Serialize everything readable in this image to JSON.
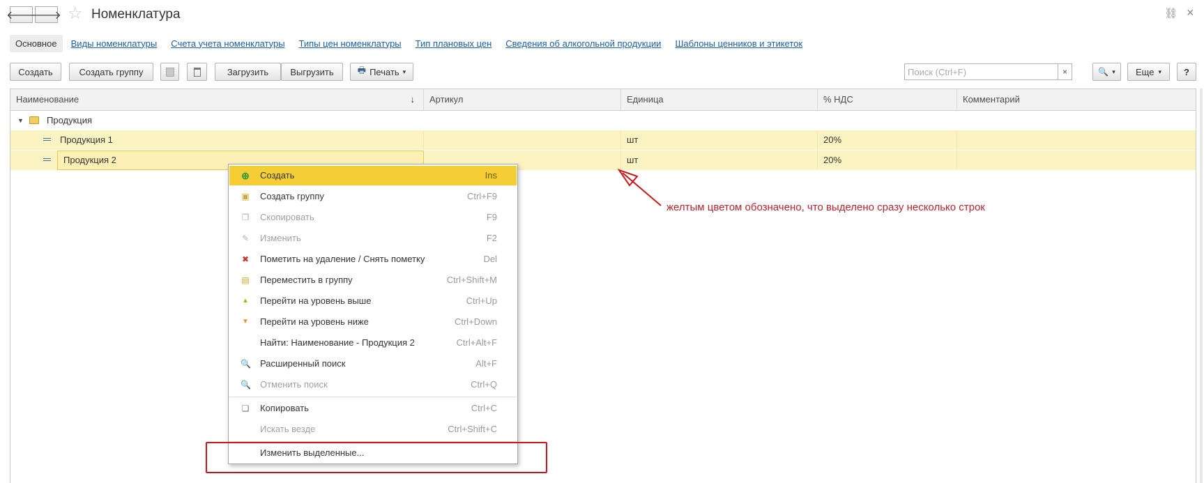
{
  "window": {
    "title": "Номенклатура",
    "back_icon": "arrow-left-icon",
    "forward_icon": "arrow-right-icon",
    "favorite_icon": "star-icon",
    "link_icon": "link-icon",
    "close_icon": "close-icon",
    "back_glyph": "🡐",
    "forward_glyph": "🡒",
    "star_glyph": "☆",
    "link_glyph": "⛓",
    "close_glyph": "×"
  },
  "tabs": [
    {
      "label": "Основное",
      "active": true
    },
    {
      "label": "Виды номенклатуры"
    },
    {
      "label": "Счета учета номенклатуры"
    },
    {
      "label": "Типы цен номенклатуры"
    },
    {
      "label": "Тип плановых цен"
    },
    {
      "label": "Сведения об алкогольной продукции"
    },
    {
      "label": "Шаблоны ценников и этикеток"
    }
  ],
  "toolbar": {
    "create": "Создать",
    "create_group": "Создать группу",
    "load": "Загрузить",
    "unload": "Выгрузить",
    "print": "Печать",
    "print_glyph": "🖶",
    "dropdown_glyph": "▾",
    "search_placeholder": "Поиск (Ctrl+F)",
    "search_clear": "×",
    "search_glyph": "🔍",
    "more": "Еще",
    "help": "?"
  },
  "table": {
    "columns": [
      "Наименование",
      "Артикул",
      "Единица",
      "% НДС",
      "Комментарий"
    ],
    "sort_glyph": "↓",
    "group": {
      "name": "Продукция",
      "expand_glyph": "▼"
    },
    "rows": [
      {
        "name": "Продукция 1",
        "article": "",
        "unit": "шт",
        "vat": "20%",
        "comment": ""
      },
      {
        "name": "Продукция 2",
        "article": "",
        "unit": "шт",
        "vat": "20%",
        "comment": ""
      }
    ]
  },
  "context_menu": {
    "items": [
      {
        "label": "Создать",
        "key": "Ins",
        "icon": "plus-circle-icon",
        "glyph": "⊕",
        "color": "#2e9b3a"
      },
      {
        "label": "Создать группу",
        "key": "Ctrl+F9",
        "icon": "add-folder-icon",
        "glyph": "▣",
        "color": "#d3a32c"
      },
      {
        "label": "Скопировать",
        "key": "F9",
        "icon": "copy-item-icon",
        "glyph": "❐",
        "color": "#b0b0b0"
      },
      {
        "label": "Изменить",
        "key": "F2",
        "icon": "pencil-icon",
        "glyph": "✎",
        "color": "#b0b0b0"
      },
      {
        "label": "Пометить на удаление / Снять пометку",
        "key": "Del",
        "icon": "delete-mark-icon",
        "glyph": "✖",
        "color": "#cc3333"
      },
      {
        "label": "Переместить в группу",
        "key": "Ctrl+Shift+M",
        "icon": "move-to-group-icon",
        "glyph": "▤",
        "color": "#d3a32c"
      },
      {
        "label": "Перейти на уровень выше",
        "key": "Ctrl+Up",
        "icon": "level-up-icon",
        "glyph": "▲",
        "color": "#d3a32c"
      },
      {
        "label": "Перейти на уровень ниже",
        "key": "Ctrl+Down",
        "icon": "level-down-icon",
        "glyph": "▼",
        "color": "#d3a32c"
      },
      {
        "label": "Найти: Наименование - Продукция 2",
        "key": "Ctrl+Alt+F",
        "icon": "",
        "glyph": "",
        "color": ""
      },
      {
        "label": "Расширенный поиск",
        "key": "Alt+F",
        "icon": "search-icon",
        "glyph": "🔍",
        "color": "#2f6c9e"
      },
      {
        "label": "Отменить поиск",
        "key": "Ctrl+Q",
        "icon": "cancel-search-icon",
        "glyph": "🔍",
        "color": "#bbbbbb"
      },
      {
        "label": "Копировать",
        "key": "Ctrl+C",
        "icon": "copy-icon",
        "glyph": "❏",
        "color": "#777777"
      },
      {
        "label": "Искать везде",
        "key": "Ctrl+Shift+C",
        "icon": "",
        "glyph": "",
        "color": ""
      },
      {
        "label": "Изменить выделенные...",
        "key": "",
        "icon": "",
        "glyph": "",
        "color": ""
      }
    ]
  },
  "annotation": {
    "text": "желтым цветом обозначено, что выделено сразу несколько строк",
    "color": "#b3262e"
  },
  "colors": {
    "accent_yellow": "#f5cd35",
    "selection_row": "#fcf3c2",
    "link_blue": "#1a5fa8",
    "annotation_red": "#c8171a"
  }
}
